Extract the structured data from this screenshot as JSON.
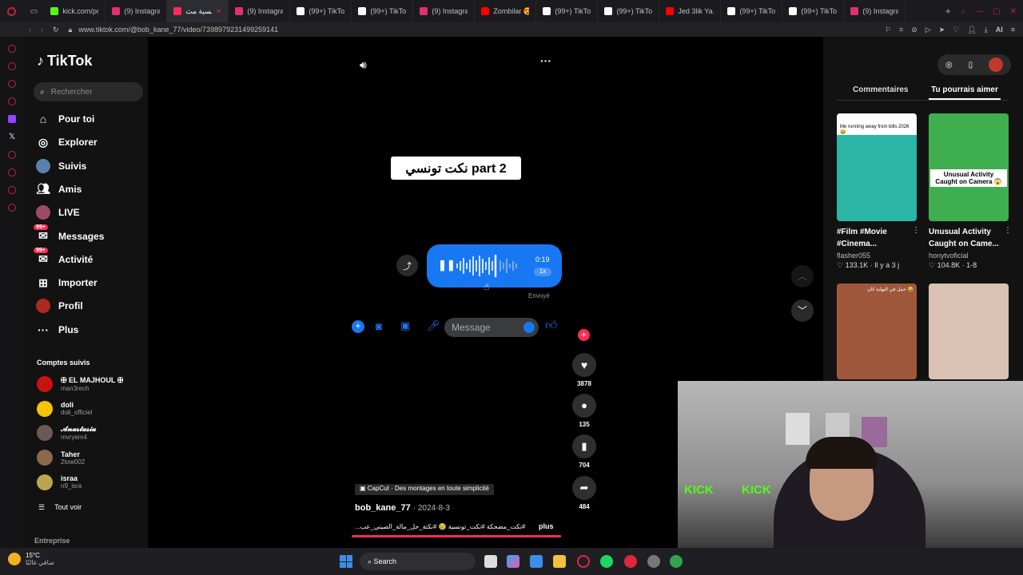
{
  "tabs": [
    {
      "title": "kick.com/po",
      "color": "#53fc18"
    },
    {
      "title": "(9) Instagram",
      "color": "#e1306c"
    },
    {
      "title": "نكت تونسية مث...",
      "color": "#fe2c55",
      "active": true
    },
    {
      "title": "(9) Instagram",
      "color": "#e1306c"
    },
    {
      "title": "(99+) TikTok",
      "color": "#ffffff"
    },
    {
      "title": "(99+) TikTok",
      "color": "#ffffff"
    },
    {
      "title": "(9) Instagram",
      "color": "#e1306c"
    },
    {
      "title": "Zombilar 😍",
      "color": "#ff0000"
    },
    {
      "title": "(99+) TikTok",
      "color": "#ffffff"
    },
    {
      "title": "(99+) TikTok",
      "color": "#ffffff"
    },
    {
      "title": "Jed 3lik Ya...",
      "color": "#ff0000"
    },
    {
      "title": "(99+) TikTok",
      "color": "#ffffff"
    },
    {
      "title": "(99+) TikTok",
      "color": "#ffffff"
    },
    {
      "title": "(9) Instagram",
      "color": "#e1306c"
    }
  ],
  "url": "www.tiktok.com/@bob_kane_77/video/7398979231499259141",
  "tiktok": {
    "logo": "TikTok",
    "search_placeholder": "Rechercher",
    "nav": [
      {
        "label": "Pour toi",
        "icon": "home-icon"
      },
      {
        "label": "Explorer",
        "icon": "compass-icon"
      },
      {
        "label": "Suivis",
        "icon": "avatar-icon"
      },
      {
        "label": "Amis",
        "icon": "friends-icon"
      },
      {
        "label": "LIVE",
        "icon": "live-avatar-icon"
      },
      {
        "label": "Messages",
        "icon": "messages-icon",
        "badge": "99+"
      },
      {
        "label": "Activité",
        "icon": "activity-icon",
        "badge": "99+"
      },
      {
        "label": "Importer",
        "icon": "upload-icon"
      },
      {
        "label": "Profil",
        "icon": "profile-avatar-icon"
      },
      {
        "label": "Plus",
        "icon": "more-icon"
      }
    ],
    "followed_title": "Comptes suivis",
    "followed": [
      {
        "name": "✠ EL MAJHOUL ✠",
        "handle": "man3rech",
        "color": "#c11"
      },
      {
        "name": "doli",
        "handle": "doli_officiel",
        "color": "#f5c400"
      },
      {
        "name": "𝓐𝓷𝓪𝓼𝓽𝓪𝓼𝓲𝓪",
        "handle": "mvryem4",
        "color": "#6a5a55"
      },
      {
        "name": "Taher",
        "handle": "2tow002",
        "color": "#8a6a4a"
      },
      {
        "name": "israa",
        "handle": "n9_isra",
        "color": "#b9a64d"
      }
    ],
    "see_all": "Tout voir",
    "company": "Entreprise",
    "video": {
      "caption_box": "نكت تونسي part 2",
      "voice_time": "0:19",
      "voice_speed": "1x",
      "sent": "Envoyé",
      "message_placeholder": "Message",
      "capcut": "CapCut · Des montages en toute simplicité",
      "author": "bob_kane_77",
      "date": "· 2024-8-3",
      "hashtags": "#نكت_مضحكة #نكت_تونسية 😢 #نكتة_حل_مالة_الصيني_عب...",
      "more": "plus",
      "likes": "3878",
      "comments": "135",
      "saves": "704",
      "shares": "484"
    },
    "right_tabs": [
      "Commentaires",
      "Tu pourrais aimer"
    ],
    "suggestions": [
      {
        "thumb_text": "Me running away from bills 2026 😂",
        "title": "#Film #Movie #Cinema...",
        "author": "flasher055",
        "stats": "♡ 133.1K · Il y a 3 j",
        "color": "#2bb5a5"
      },
      {
        "thumb_text": "Unusual Activity Caught on Camera 😱",
        "title": "Unusual Activity Caught on Came...",
        "author": "honytvoficial",
        "stats": "♡ 104.8K · 1-8",
        "color": "#3fae4f"
      },
      {
        "thumb_text": "حمل في النهاية كان 😂",
        "color": "#a0583c"
      },
      {
        "thumb_text": "",
        "color": "#d9c2b4"
      }
    ]
  },
  "taskbar": {
    "weather_temp": "15°C",
    "weather_desc": "صافي غالبًا",
    "search": "Search"
  }
}
